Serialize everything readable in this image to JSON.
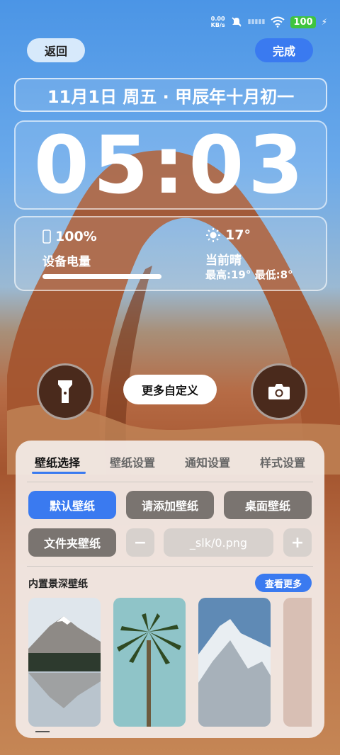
{
  "status": {
    "net_speed": "0.00",
    "net_unit": "KB/s",
    "battery": "100"
  },
  "header": {
    "back_label": "返回",
    "done_label": "完成"
  },
  "lockscreen": {
    "date": "11月1日 周五 · 甲辰年十月初一",
    "time": "05:03",
    "battery_percent": "100%",
    "battery_label": "设备电量",
    "battery_level": 1.0,
    "temperature": "17°",
    "weather": "当前晴",
    "temp_range": "最高:19° 最低:8°"
  },
  "controls": {
    "more_label": "更多自定义",
    "left_icon": "flashlight-icon",
    "right_icon": "camera-icon"
  },
  "panel": {
    "tabs": [
      "壁纸选择",
      "壁纸设置",
      "通知设置",
      "样式设置"
    ],
    "buttons": {
      "default": "默认壁纸",
      "add": "请添加壁纸",
      "desktop": "桌面壁纸",
      "folder": "文件夹壁纸",
      "minus": "−",
      "plus": "+"
    },
    "file_field_value": "_slk/0.png",
    "section_title": "内置景深壁纸",
    "see_more": "查看更多"
  },
  "colors": {
    "accent": "#3a7af0",
    "battery_green": "#3fc43f"
  }
}
